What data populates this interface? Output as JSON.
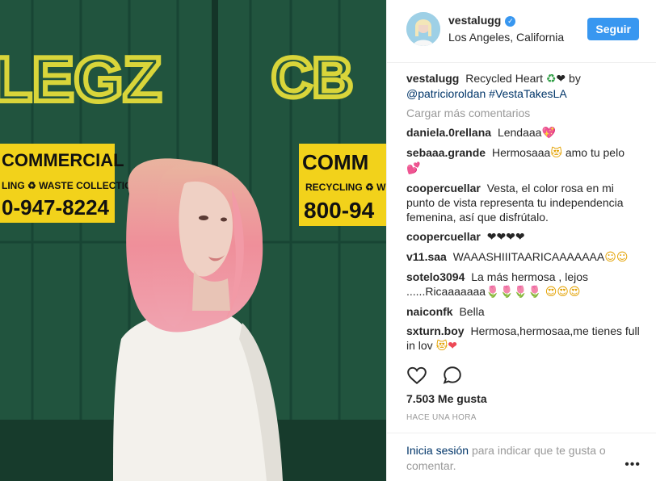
{
  "post": {
    "username": "vestalugg",
    "verified_icon": "verified-badge-icon",
    "location": "Los Angeles, California",
    "follow_label": "Seguir"
  },
  "photo": {
    "graffiti_left": "LEGZ",
    "graffiti_right": "CB",
    "sign_left_title": "COMMERCIAL",
    "sign_left_sub": "LING ♻ WASTE COLLECTION",
    "sign_left_phone": "0-947-8224",
    "sign_right_title": "COMM",
    "sign_right_sub": "RECYCLING ♻ W",
    "sign_right_phone": "800-94"
  },
  "caption": {
    "user": "vestalugg",
    "text": "Recycled Heart",
    "emoji_recycle": "♻",
    "emoji_heart": "❤",
    "by": "by",
    "mention": "@patricioroldan",
    "hashtag": "#VestaTakesLA"
  },
  "load_more": "Cargar más comentarios",
  "comments": [
    {
      "user": "daniela.0rellana",
      "text": "Lendaaa",
      "emoji": "💖"
    },
    {
      "user": "sebaaa.grande",
      "text": "Hermosaaa",
      "emoji": "😻",
      "text2": "amo tu pelo",
      "emoji2": "💕"
    },
    {
      "user": "coopercuellar",
      "text": "Vesta, el color rosa en mi punto de vista representa tu independencia femenina, así que disfrútalo."
    },
    {
      "user": "coopercuellar",
      "emoji": "❤❤❤❤"
    },
    {
      "user": "v11.saa",
      "text": "WAAASHIIITAARICAAAAAAA",
      "emoji": "☺☺"
    },
    {
      "user": "sotelo3094",
      "text": "La más hermosa , lejos ......Ricaaaaaaa",
      "emoji": "🌷🌷🌷🌷",
      "emoji2": "😍😍😍"
    },
    {
      "user": "naiconfk",
      "text": "Bella"
    },
    {
      "user": "sxturn.boy",
      "text": "Hermosa,hermosaa,me tienes full in lov",
      "emoji": "😻",
      "emoji2": "❤"
    }
  ],
  "actions": {
    "like_icon": "heart-outline-icon",
    "comment_icon": "comment-bubble-icon"
  },
  "likes": "7.503 Me gusta",
  "timestamp": "HACE UNA HORA",
  "footer": {
    "login_link": "Inicia sesión",
    "login_text": "para indicar que te gusta o comentar.",
    "more_label": "•••"
  },
  "colors": {
    "accent": "#3897f0",
    "link": "#003569",
    "muted": "#999999",
    "dumpster_green": "#1d4a37",
    "sign_yellow": "#f2d21b",
    "graffiti_yellow": "#d9d53a"
  }
}
